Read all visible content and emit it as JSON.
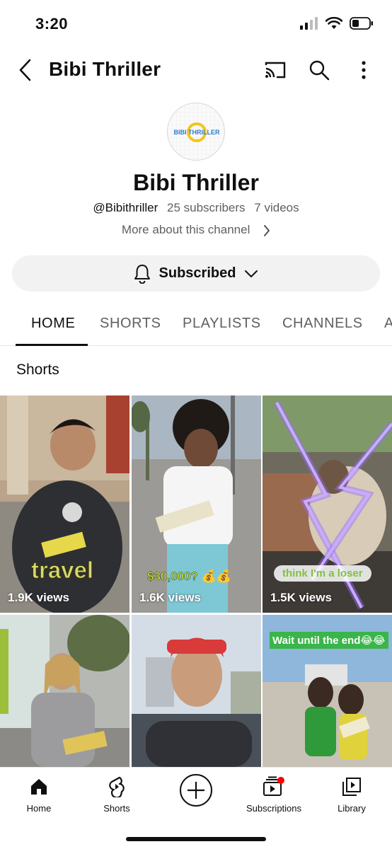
{
  "status_bar": {
    "time": "3:20"
  },
  "header": {
    "title": "Bibi Thriller"
  },
  "channel": {
    "avatar_text": "BIBI THRILLER",
    "name": "Bibi Thriller",
    "handle": "@Bibithriller",
    "subscribers": "25 subscribers",
    "videos": "7 videos",
    "more_about": "More about this channel",
    "subscribe_label": "Subscribed"
  },
  "tabs": [
    {
      "label": "HOME",
      "active": true
    },
    {
      "label": "SHORTS"
    },
    {
      "label": "PLAYLISTS"
    },
    {
      "label": "CHANNELS"
    },
    {
      "label": "A"
    }
  ],
  "section": {
    "title": "Shorts"
  },
  "shorts": [
    {
      "views": "1.9K views",
      "caption": "travel"
    },
    {
      "views": "1.6K views",
      "caption": "$30,000? 💰💰"
    },
    {
      "views": "1.5K views",
      "caption": "think I'm a loser"
    },
    {
      "views": "",
      "caption": ""
    },
    {
      "views": "",
      "caption": ""
    },
    {
      "views": "",
      "caption": "Wait until the end😂😂"
    }
  ],
  "bottom_nav": [
    {
      "label": "Home",
      "icon": "home-icon"
    },
    {
      "label": "Shorts",
      "icon": "shorts-icon"
    },
    {
      "label": "",
      "icon": "create-icon"
    },
    {
      "label": "Subscriptions",
      "icon": "subscriptions-icon"
    },
    {
      "label": "Library",
      "icon": "library-icon"
    }
  ],
  "colors": {
    "notification_dot": "#ff0000",
    "subscribe_bg": "#f2f2f2"
  }
}
